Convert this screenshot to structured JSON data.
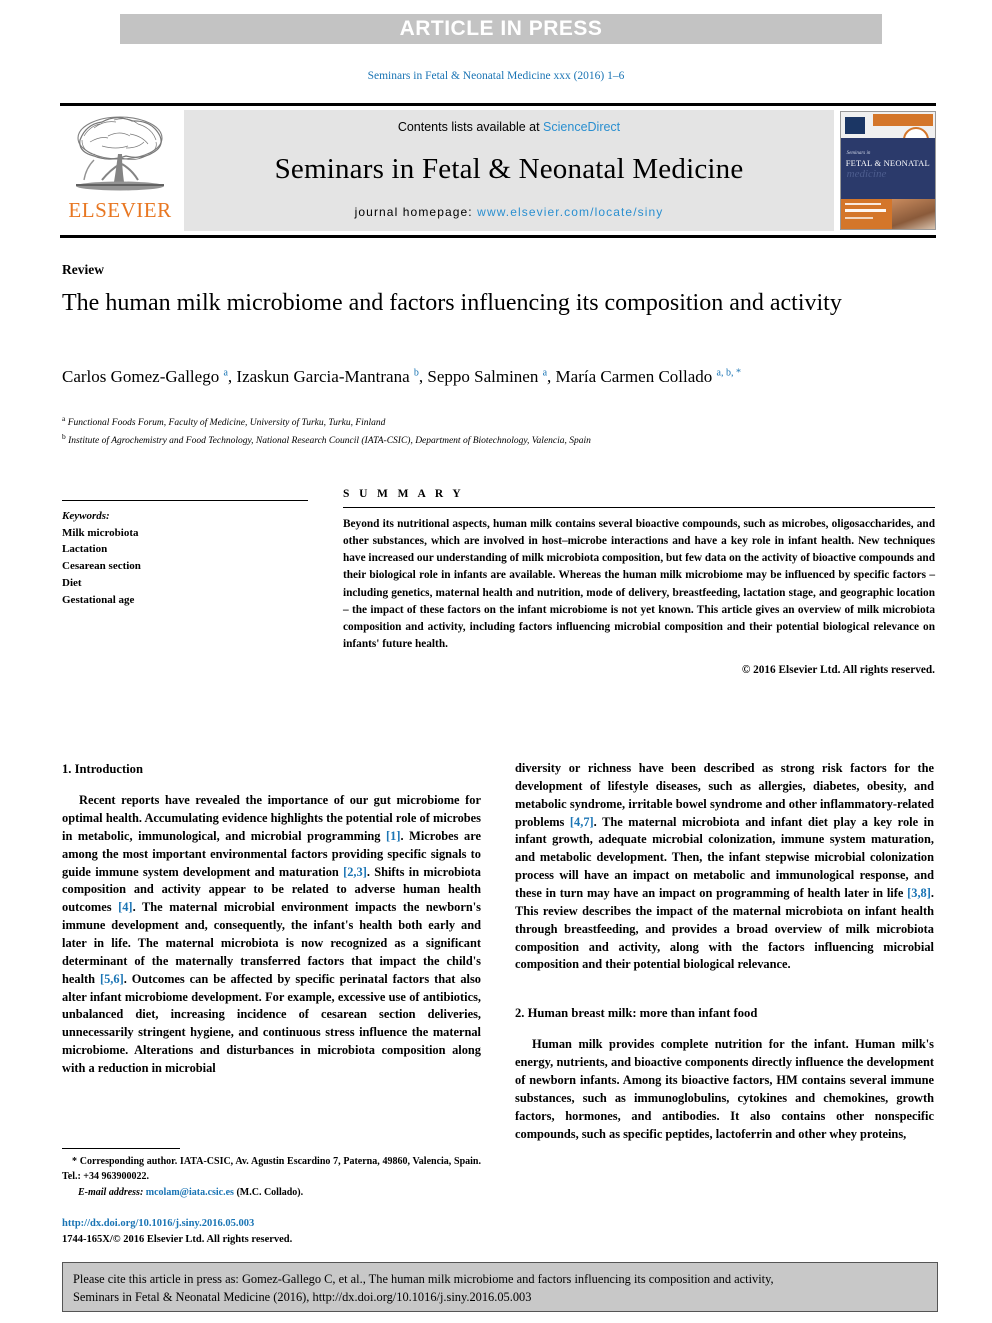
{
  "banner": {
    "text": "ARTICLE IN PRESS"
  },
  "running_head": "Seminars in Fetal & Neonatal Medicine xxx (2016) 1–6",
  "masthead": {
    "publisher": "ELSEVIER",
    "contents_prefix": "Contents lists available at ",
    "contents_link": "ScienceDirect",
    "journal_name": "Seminars in Fetal & Neonatal Medicine",
    "homepage_prefix": "journal homepage: ",
    "homepage_url": "www.elsevier.com/locate/siny",
    "cover": {
      "line1": "Seminars in",
      "line2": "FETAL & NEONATAL",
      "line3": "medicine"
    }
  },
  "article": {
    "type": "Review",
    "title": "The human milk microbiome and factors influencing its composition and activity",
    "authors_html": "Carlos Gomez-Gallego <sup>a</sup>, Izaskun Garcia-Mantrana <sup>b</sup>, Seppo Salminen <sup>a</sup>, María Carmen Collado <sup>a, b, *</sup>",
    "affiliations": [
      "Functional Foods Forum, Faculty of Medicine, University of Turku, Turku, Finland",
      "Institute of Agrochemistry and Food Technology, National Research Council (IATA-CSIC), Department of Biotechnology, Valencia, Spain"
    ],
    "affiliation_marks": [
      "a",
      "b"
    ]
  },
  "keywords": {
    "heading": "Keywords:",
    "items": [
      "Milk microbiota",
      "Lactation",
      "Cesarean section",
      "Diet",
      "Gestational age"
    ]
  },
  "summary": {
    "heading": "S U M M A R Y",
    "body": "Beyond its nutritional aspects, human milk contains several bioactive compounds, such as microbes, oligosaccharides, and other substances, which are involved in host–microbe interactions and have a key role in infant health. New techniques have increased our understanding of milk microbiota composition, but few data on the activity of bioactive compounds and their biological role in infants are available. Whereas the human milk microbiome may be influenced by specific factors – including genetics, maternal health and nutrition, mode of delivery, breastfeeding, lactation stage, and geographic location – the impact of these factors on the infant microbiome is not yet known. This article gives an overview of milk microbiota composition and activity, including factors influencing microbial composition and their potential biological relevance on infants' future health.",
    "copyright": "© 2016 Elsevier Ltd. All rights reserved."
  },
  "body": {
    "section1_heading": "1. Introduction",
    "section1_p1_part1": "Recent reports have revealed the importance of our gut microbiome for optimal health. Accumulating evidence highlights the potential role of microbes in metabolic, immunological, and microbial programming ",
    "ref1": "[1]",
    "section1_p1_part2": ". Microbes are among the most important environmental factors providing specific signals to guide immune system development and maturation ",
    "ref2": "[2,3]",
    "section1_p1_part3": ". Shifts in microbiota composition and activity appear to be related to adverse human health outcomes ",
    "ref3": "[4]",
    "section1_p1_part4": ". The maternal microbial environment impacts the newborn's immune development and, consequently, the infant's health both early and later in life. The maternal microbiota is now recognized as a significant determinant of the maternally transferred factors that impact the child's health ",
    "ref4": "[5,6]",
    "section1_p1_part5": ". Outcomes can be affected by specific perinatal factors that also alter infant microbiome development. For example, excessive use of antibiotics, unbalanced diet, increasing incidence of cesarean section deliveries, unnecessarily stringent hygiene, and continuous stress influence the maternal microbiome. Alterations and disturbances in microbiota composition along with a reduction in microbial",
    "section1_p1_cont1": "diversity or richness have been described as strong risk factors for the development of lifestyle diseases, such as allergies, diabetes, obesity, and metabolic syndrome, irritable bowel syndrome and other inflammatory-related problems ",
    "ref5": "[4,7]",
    "section1_p1_cont2": ". The maternal microbiota and infant diet play a key role in infant growth, adequate microbial colonization, immune system maturation, and metabolic development. Then, the infant stepwise microbial colonization process will have an impact on metabolic and immunological response, and these in turn may have an impact on programming of health later in life ",
    "ref6": "[3,8]",
    "section1_p1_cont3": ". This review describes the impact of the maternal microbiota on infant health through breastfeeding, and provides a broad overview of milk microbiota composition and activity, along with the factors influencing microbial composition and their potential biological relevance.",
    "section2_heading": "2. Human breast milk: more than infant food",
    "section2_p1": "Human milk provides complete nutrition for the infant. Human milk's energy, nutrients, and bioactive components directly influence the development of newborn infants. Among its bioactive factors, HM contains several immune substances, such as immunoglobulins, cytokines and chemokines, growth factors, hormones, and antibodies. It also contains other nonspecific compounds, such as specific peptides, lactoferrin and other whey proteins,"
  },
  "footnote": {
    "corresponding": "* Corresponding author. IATA-CSIC, Av. Agustin Escardino 7, Paterna, 49860, Valencia, Spain. Tel.: +34 963900022.",
    "email_label": "E-mail address:",
    "email": "mcolam@iata.csic.es",
    "email_suffix": "(M.C. Collado)."
  },
  "doi_block": {
    "doi": "http://dx.doi.org/10.1016/j.siny.2016.05.003",
    "issn_line": "1744-165X/© 2016 Elsevier Ltd. All rights reserved."
  },
  "citation_bar": {
    "line1": "Please cite this article in press as: Gomez-Gallego C, et al., The human milk microbiome and factors influencing its composition and activity,",
    "line2": "Seminars in Fetal & Neonatal Medicine (2016), http://dx.doi.org/10.1016/j.siny.2016.05.003"
  },
  "colors": {
    "link_blue": "#1a74b4",
    "science_direct_blue": "#2a8fd0",
    "elsevier_orange": "#e87722",
    "banner_gray": "#c3c3c3",
    "masthead_gray": "#e4e4e4",
    "cite_bar_gray": "#c8c8c8"
  }
}
